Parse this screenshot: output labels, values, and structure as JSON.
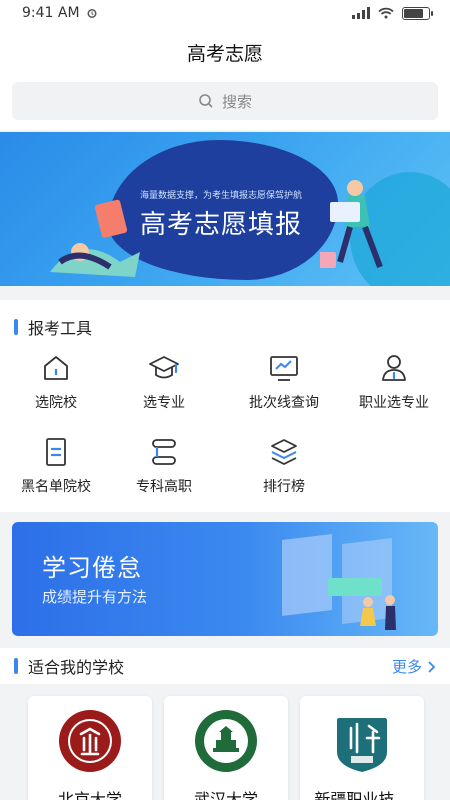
{
  "status_bar": {
    "time": "9:41 AM"
  },
  "nav": {
    "title": "高考志愿"
  },
  "search": {
    "placeholder": "搜索"
  },
  "banner": {
    "subtitle": "海量数据支撑，为考生填报志愿保驾护航",
    "title": "高考志愿填报"
  },
  "tools_section": {
    "title": "报考工具",
    "items": [
      {
        "label": "选院校",
        "icon": "home-icon"
      },
      {
        "label": "选专业",
        "icon": "graduation-cap-icon"
      },
      {
        "label": "批次线查询",
        "icon": "chart-monitor-icon"
      },
      {
        "label": "职业选专业",
        "icon": "person-icon"
      },
      {
        "label": "黑名单院校",
        "icon": "document-icon"
      },
      {
        "label": "专科高职",
        "icon": "s-shape-icon"
      },
      {
        "label": "排行榜",
        "icon": "layers-icon"
      }
    ]
  },
  "promo": {
    "title": "学习倦怠",
    "subtitle": "成绩提升有方法"
  },
  "schools_section": {
    "title": "适合我的学校",
    "more_label": "更多",
    "schools": [
      {
        "name": "北京大学"
      },
      {
        "name": "武汉大学"
      },
      {
        "name": "新疆职业技..."
      }
    ]
  },
  "colors": {
    "accent": "#3a87f2",
    "peking_red": "#9b1b1b",
    "wuhan_green": "#1f6b3a",
    "xinjiang_teal": "#1d6f79"
  }
}
